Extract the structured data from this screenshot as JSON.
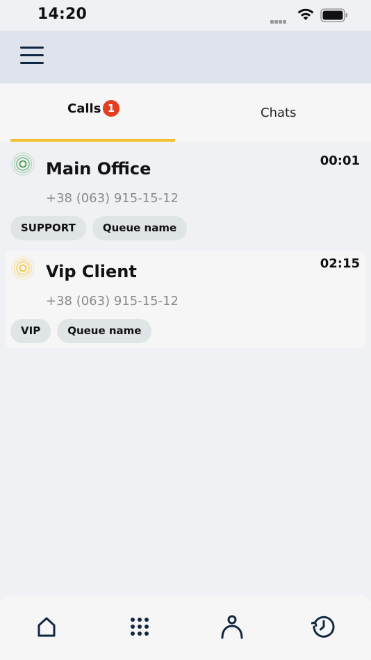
{
  "status_bar": {
    "time": "14:20"
  },
  "header": {
    "menu_icon": "hamburger-menu-icon"
  },
  "tabs": {
    "calls": {
      "label": "Calls",
      "badge": "1"
    },
    "chats": {
      "label": "Chats"
    },
    "active": "calls"
  },
  "calls": [
    {
      "name": "Main Office",
      "phone": "+38 (063) 915-15-12",
      "timer": "00:01",
      "status_color": "#43a047",
      "tags": [
        "SUPPORT",
        "Queue name"
      ]
    },
    {
      "name": "Vip Client",
      "phone": "+38 (063) 915-15-12",
      "timer": "02:15",
      "status_color": "#f5c132",
      "tags": [
        "VIP",
        "Queue name"
      ]
    }
  ],
  "bottom_nav": {
    "items": [
      "home-icon",
      "dialpad-icon",
      "contacts-icon",
      "history-icon"
    ]
  },
  "colors": {
    "accent": "#f5c132",
    "badge": "#e23e1f",
    "icon": "#0f2740"
  }
}
